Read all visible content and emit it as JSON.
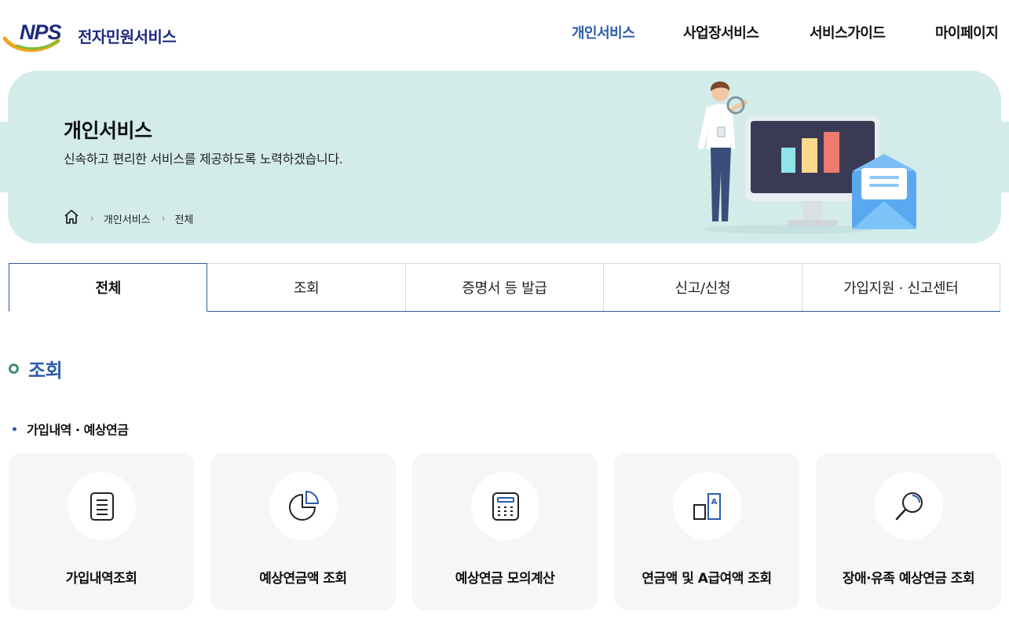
{
  "header": {
    "logo_mark": "NPS",
    "logo_text": "전자민원서비스",
    "nav": [
      "개인서비스",
      "사업장서비스",
      "서비스가이드",
      "마이페이지"
    ],
    "active_nav": "개인서비스"
  },
  "banner": {
    "title": "개인서비스",
    "subtitle": "신속하고 편리한 서비스를 제공하도록 노력하겠습니다.",
    "breadcrumb": [
      "개인서비스",
      "전체"
    ],
    "icon": "home-icon",
    "background": "#d3ecea"
  },
  "tabs": [
    "전체",
    "조회",
    "증명서 등 발급",
    "신고/신청",
    "가입지원 · 신고센터"
  ],
  "section": {
    "title": "조회",
    "subsection": "가입내역 · 예상연금",
    "cards": [
      {
        "label": "가입내역조회",
        "icon": "document-icon"
      },
      {
        "label": "예상연금액 조회",
        "icon": "pie-chart-icon"
      },
      {
        "label": "예상연금 모의계산",
        "icon": "calculator-icon"
      },
      {
        "label": "연금액 및 A급여액 조회",
        "icon": "bar-a-icon"
      },
      {
        "label": "장애·유족 예상연금 조회",
        "icon": "search-icon"
      }
    ]
  },
  "colors": {
    "accent": "#2b5caa",
    "section_dot": "#3f8f6e",
    "card_bg": "#f6f6f6"
  }
}
